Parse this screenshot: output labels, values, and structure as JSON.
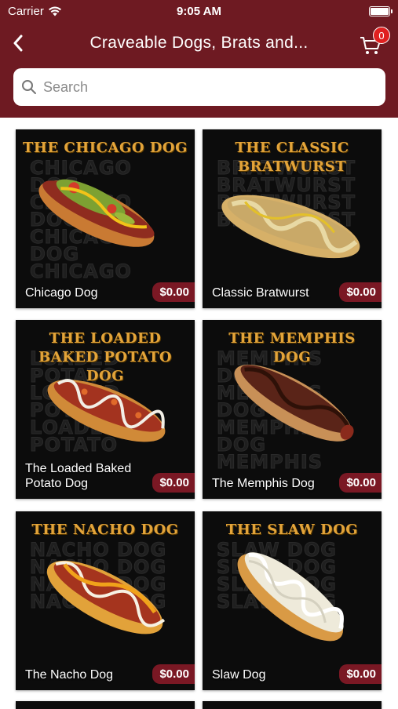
{
  "status": {
    "carrier": "Carrier",
    "time": "9:05 AM"
  },
  "nav": {
    "title": "Craveable Dogs, Brats and...",
    "cart_count": "0"
  },
  "search": {
    "placeholder": "Search"
  },
  "colors": {
    "brand": "#6e1a22",
    "price_tag": "#7a1824",
    "heading_gold": "#e3a43a",
    "badge": "#e02020"
  },
  "items": [
    {
      "heading": "THE CHICAGO DOG",
      "bg": "CHICAGO DOG CHICAGO DOG CHICAGO DOG CHICAGO DOG CHICAGO DOG",
      "name": "Chicago Dog",
      "price": "$0.00"
    },
    {
      "heading": "THE CLASSIC BRATWURST",
      "bg": "BRATWURST BRATWURST BRATWURST BRATWURST",
      "name": "Classic Bratwurst",
      "price": "$0.00"
    },
    {
      "heading": "THE LOADED BAKED POTATO DOG",
      "bg": "LOADED POTATO LOADED POTATO LOADED POTATO",
      "name": "The Loaded Baked Potato Dog",
      "price": "$0.00"
    },
    {
      "heading": "THE MEMPHIS DOG",
      "bg": "MEMPHIS DOG MEMPHIS DOG MEMPHIS DOG MEMPHIS",
      "name": "The Memphis Dog",
      "price": "$0.00"
    },
    {
      "heading": "THE NACHO DOG",
      "bg": "NACHO DOG NACHO DOG NACHO DOG NACHO DOG",
      "name": "The Nacho Dog",
      "price": "$0.00"
    },
    {
      "heading": "THE SLAW DOG",
      "bg": "SLAW DOG SLAW DOG SLAW DOG SLAW DOG",
      "name": "Slaw Dog",
      "price": "$0.00"
    }
  ]
}
